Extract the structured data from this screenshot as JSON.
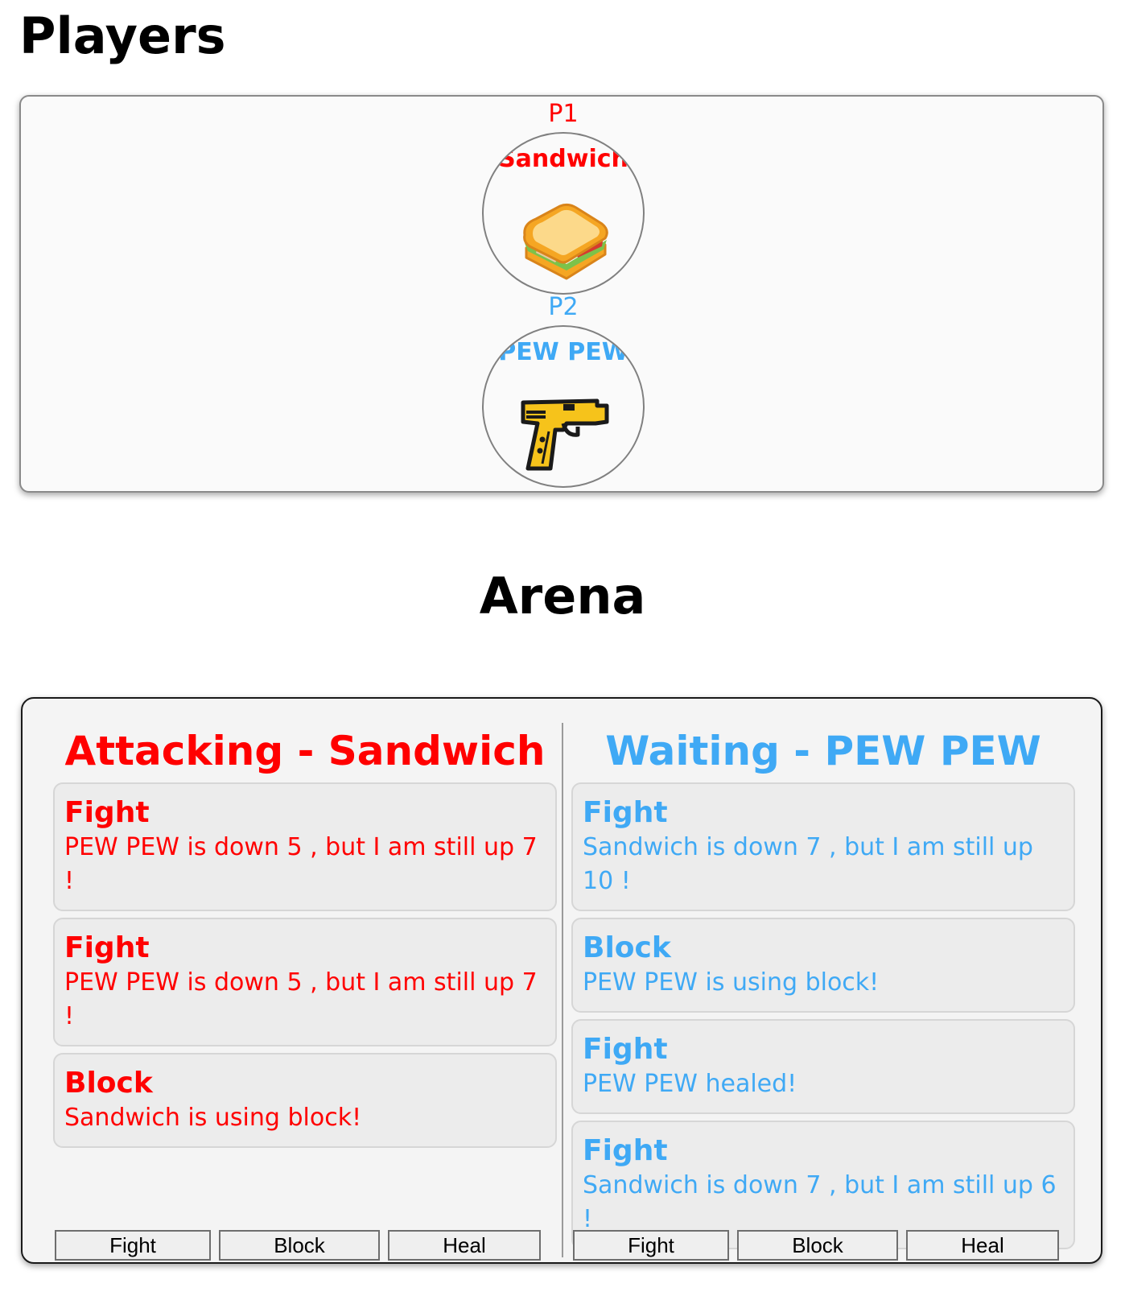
{
  "players": {
    "title": "Players",
    "list": [
      {
        "label": "P1",
        "name": "Sandwich",
        "icon": "sandwich-icon",
        "color": "#ff0000"
      },
      {
        "label": "P2",
        "name": "PEW PEW",
        "icon": "pistol-icon",
        "color": "#3fa9f5"
      }
    ]
  },
  "arena": {
    "title": "Arena",
    "left": {
      "heading": "Attacking - Sandwich",
      "color": "#ff0000",
      "log": [
        {
          "action": "Fight",
          "message": "PEW PEW is down 5 , but I am still up 7 !"
        },
        {
          "action": "Fight",
          "message": "PEW PEW is down 5 , but I am still up 7 !"
        },
        {
          "action": "Block",
          "message": "Sandwich is using block!"
        }
      ],
      "buttons": {
        "fight": "Fight",
        "block": "Block",
        "heal": "Heal"
      }
    },
    "right": {
      "heading": "Waiting - PEW PEW",
      "color": "#3fa9f5",
      "log": [
        {
          "action": "Fight",
          "message": "Sandwich is down 7 , but I am still up 10 !"
        },
        {
          "action": "Block",
          "message": "PEW PEW is using block!"
        },
        {
          "action": "Fight",
          "message": "PEW PEW healed!"
        },
        {
          "action": "Fight",
          "message": "Sandwich is down 7 , but I am still up 6 !"
        }
      ],
      "buttons": {
        "fight": "Fight",
        "block": "Block",
        "heal": "Heal"
      }
    }
  }
}
